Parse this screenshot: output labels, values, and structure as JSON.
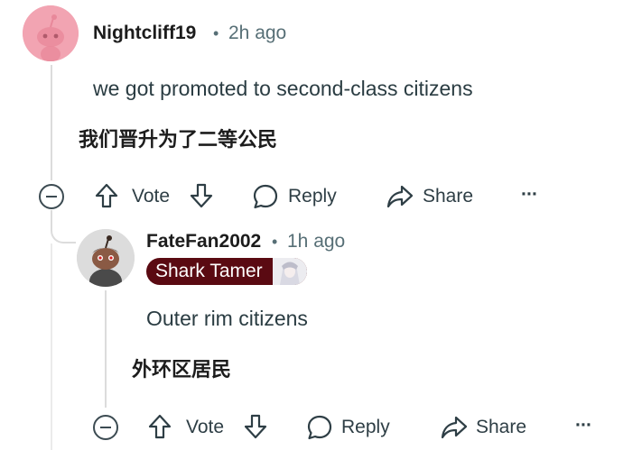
{
  "comments": [
    {
      "username": "Nightcliff19",
      "separator": "•",
      "time": "2h ago",
      "text": "we got promoted to second-class citizens",
      "translation": "我们晋升为了二等公民",
      "actions": {
        "vote_label": "Vote",
        "reply_label": "Reply",
        "share_label": "Share",
        "more_label": "···"
      }
    },
    {
      "username": "FateFan2002",
      "separator": "•",
      "time": "1h ago",
      "flair": "Shark Tamer",
      "text": "Outer rim citizens",
      "translation": "外环区居民",
      "actions": {
        "vote_label": "Vote",
        "reply_label": "Reply",
        "share_label": "Share",
        "more_label": "···"
      }
    }
  ],
  "colors": {
    "avatar_1_bg": "#f2a4b2",
    "flair_bg": "#5a0a12",
    "text_muted": "#576f76",
    "thread_line": "#dcdcdc"
  }
}
